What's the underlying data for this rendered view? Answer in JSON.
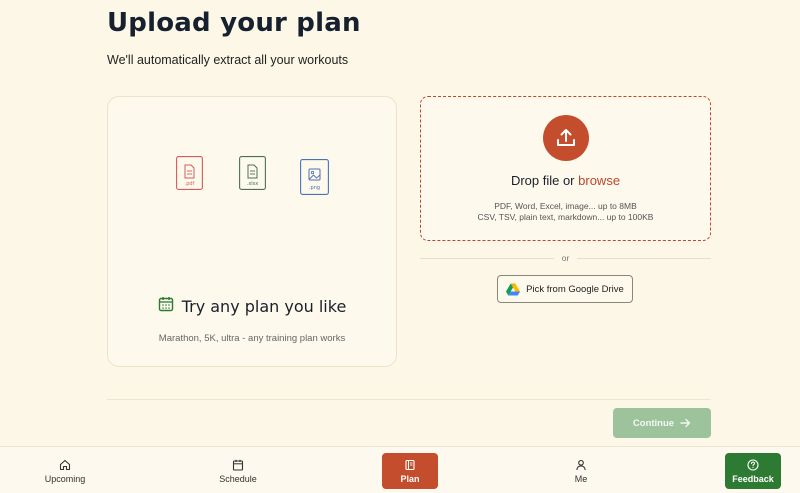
{
  "header": {
    "title": "Upload your plan",
    "subtitle": "We'll automatically extract all your workouts"
  },
  "plan_card": {
    "file_types": [
      {
        "label": ".pdf",
        "color": "#d45a5a",
        "icon": "pdf-file-icon"
      },
      {
        "label": ".xlsx",
        "color": "#4f6e58",
        "icon": "spreadsheet-file-icon"
      },
      {
        "label": ".png",
        "color": "#4b72b5",
        "icon": "image-file-icon"
      }
    ],
    "heading": "Try any plan you like",
    "caption": "Marathon, 5K, ultra - any training plan works",
    "heading_icon_color": "#2d7a33"
  },
  "drop_zone": {
    "title_prefix": "Drop file or ",
    "browse_label": "browse",
    "info_line_1": "PDF, Word, Excel, image... up to 8MB",
    "info_line_2": "CSV, TSV, plain text, markdown... up to 100KB",
    "accent_color": "#c34d2d"
  },
  "separator": {
    "label": "or"
  },
  "google_drive": {
    "label": "Pick from Google Drive"
  },
  "footer": {
    "continue_label": "Continue"
  },
  "bottom_nav": {
    "items": [
      {
        "label": "Upcoming",
        "icon": "home-icon"
      },
      {
        "label": "Schedule",
        "icon": "calendar-icon"
      },
      {
        "label": "Plan",
        "icon": "plan-icon",
        "active": true
      },
      {
        "label": "Me",
        "icon": "person-icon"
      }
    ],
    "feedback_label": "Feedback"
  }
}
